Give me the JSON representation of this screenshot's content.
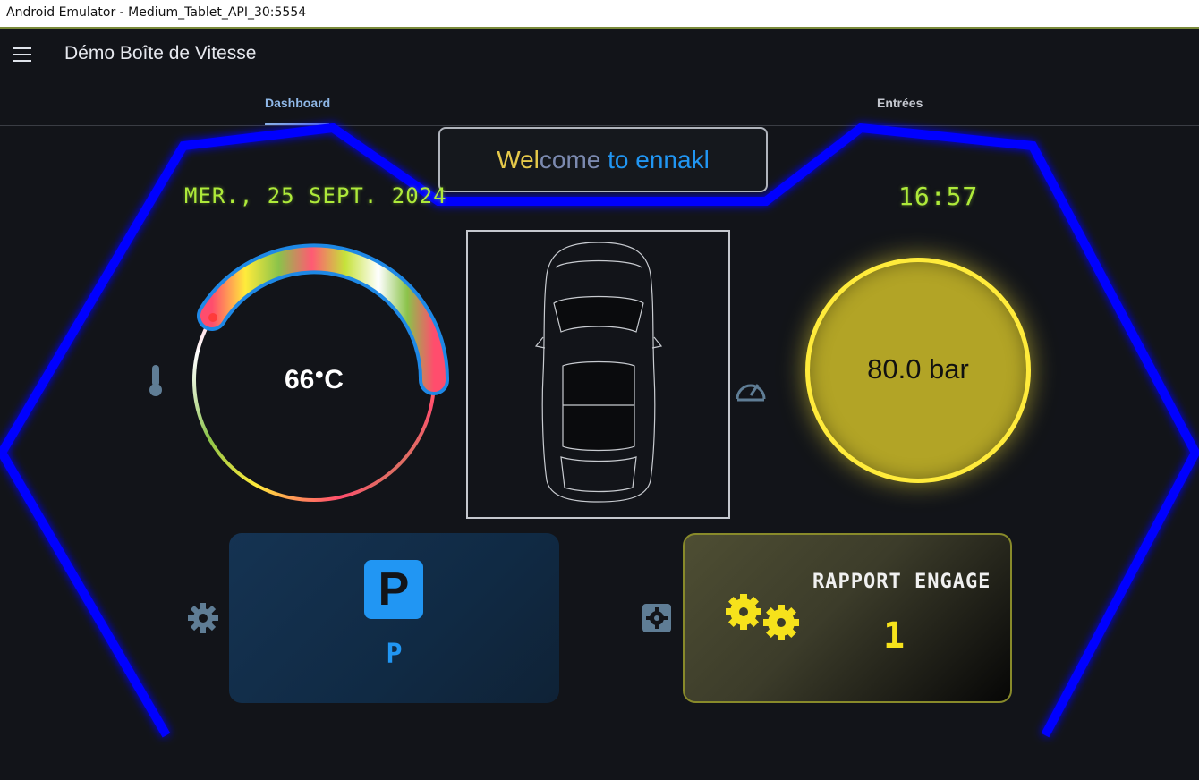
{
  "window": {
    "title": "Android Emulator - Medium_Tablet_API_30:5554"
  },
  "appbar": {
    "title": "Démo Boîte de Vitesse",
    "menu_icon": "menu-icon"
  },
  "tabs": [
    {
      "label": "Dashboard",
      "active": true
    },
    {
      "label": "Entrées",
      "active": false
    }
  ],
  "welcome": {
    "part1": "Wel",
    "part2": "come",
    "part3": " to ennakl"
  },
  "date": "MER., 25 SEPT. 2024",
  "time": "16:57",
  "temperature": {
    "value": "66",
    "unit": "C",
    "icon": "thermometer-icon"
  },
  "pressure": {
    "value": "80.0 bar",
    "icon": "speedometer-icon"
  },
  "park": {
    "badge": "P",
    "value": "P",
    "icon": "gear-icon"
  },
  "rapport": {
    "label": "RAPPORT ENGAGE",
    "value": "1",
    "icon": "gear-icon"
  },
  "colors": {
    "frame": "#0000ff",
    "accent": "#2196f3",
    "digital": "#aeea3a",
    "pressure_fill": "#b2a426",
    "pressure_ring": "#ffeb3b"
  }
}
